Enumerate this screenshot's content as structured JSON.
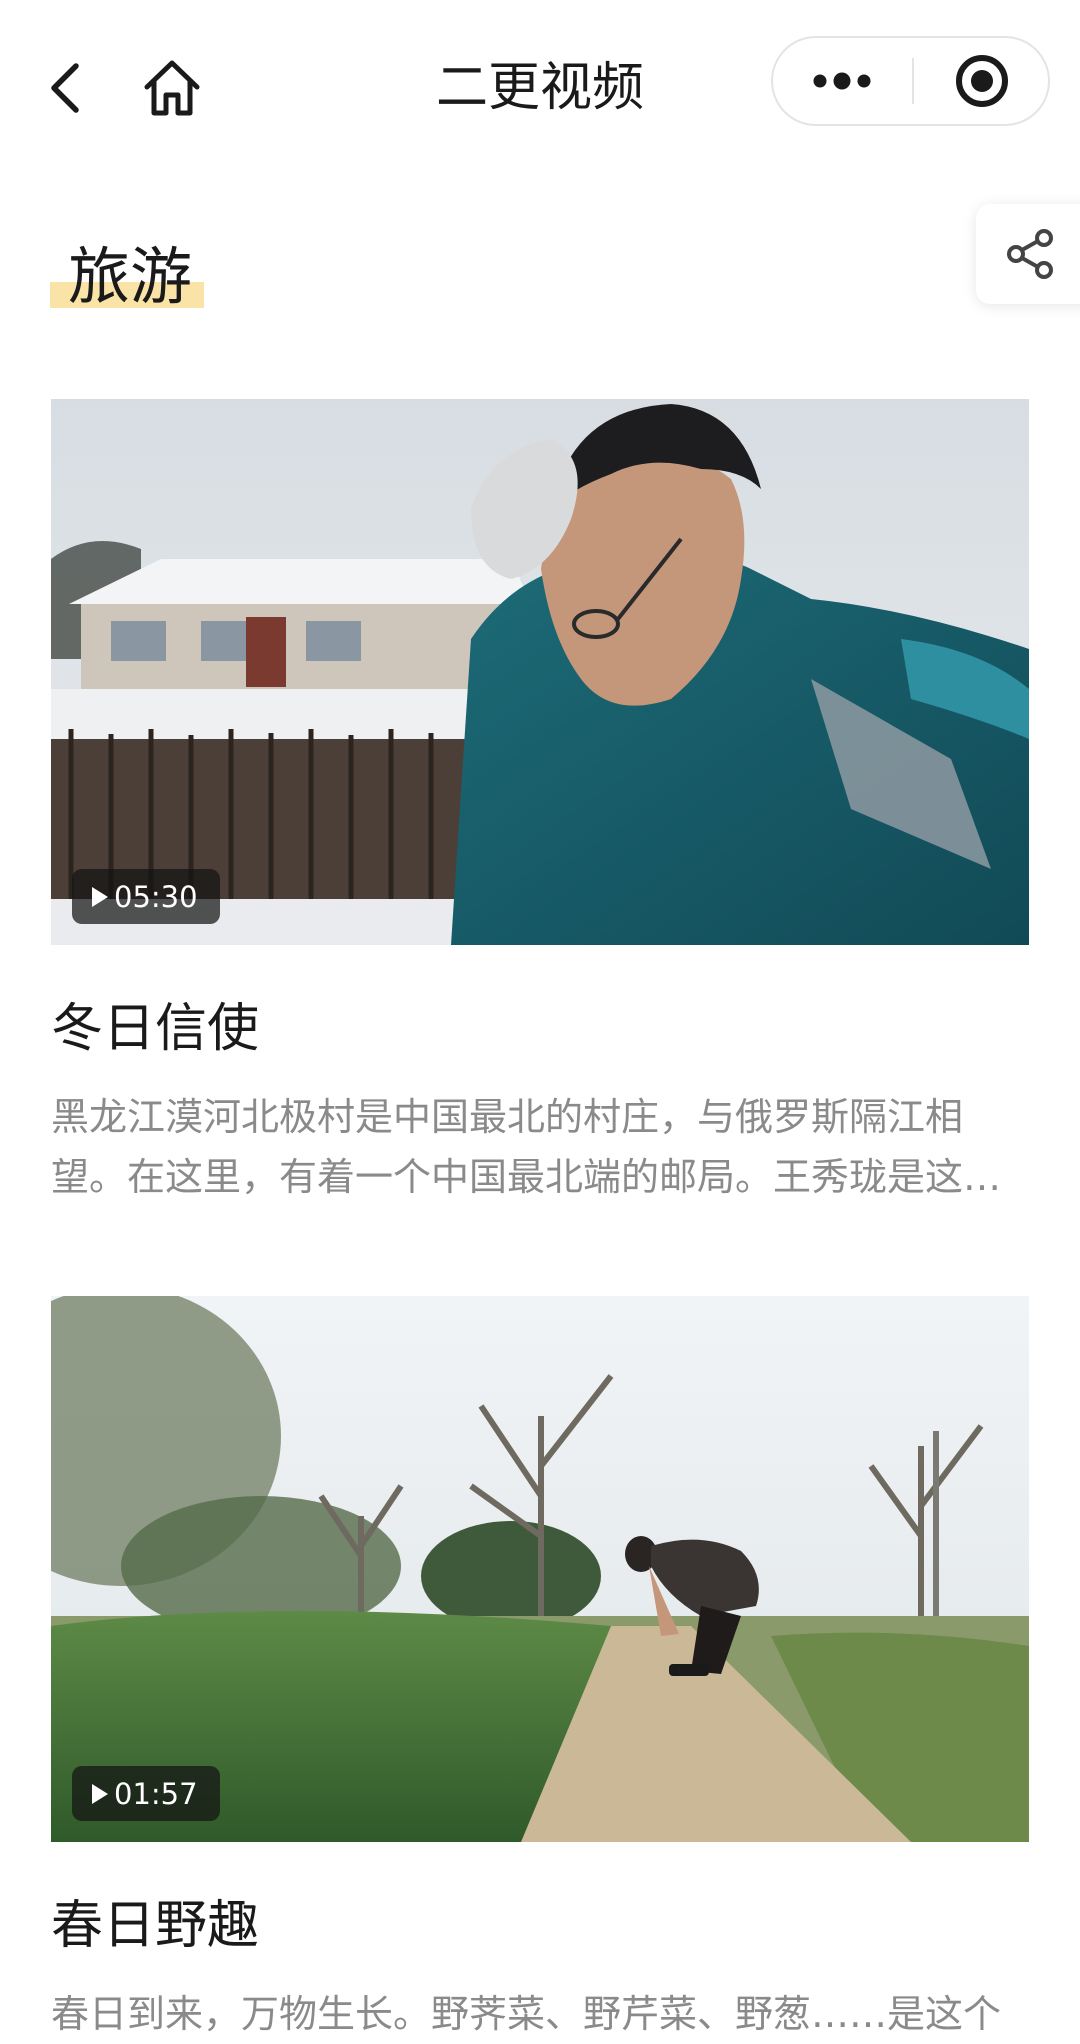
{
  "navbar": {
    "title": "二更视频",
    "icons": {
      "back": "chevron-left-icon",
      "home": "home-icon",
      "more": "more-dots-icon",
      "close": "target-circle-icon"
    }
  },
  "section": {
    "title": "旅游",
    "highlight_color": "#f9e3a6",
    "share_icon": "share-icon"
  },
  "videos": [
    {
      "duration": "05:30",
      "title": "冬日信使",
      "description": "黑龙江漠河北极村是中国最北的村庄，与俄罗斯隔江相望。在这里，有着一个中国最北端的邮局。王秀珑是这…"
    },
    {
      "duration": "01:57",
      "title": "春日野趣",
      "description": "春日到来，万物生长。野荠菜、野芹菜、野葱……是这个"
    }
  ]
}
